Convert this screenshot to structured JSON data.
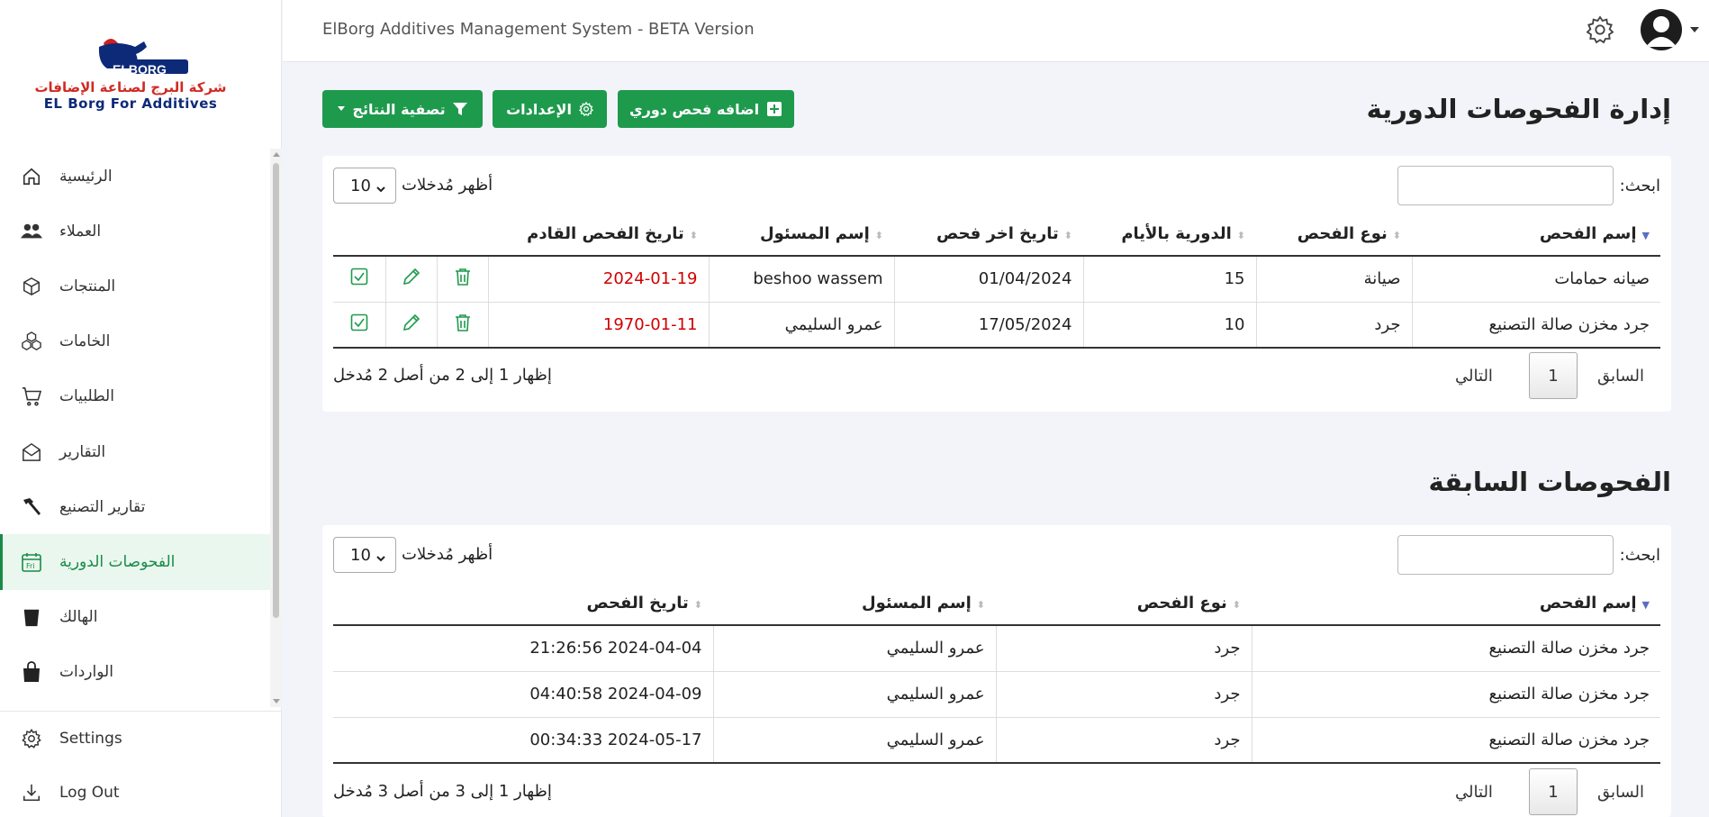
{
  "brand": {
    "logo_text": "ELBORG",
    "arabic_name": "شركة البرج لصناعة الإضافات",
    "english_name": "EL Borg For Additives"
  },
  "header": {
    "title": "ElBorg Additives Management System - BETA Version"
  },
  "sidebar": {
    "items": [
      {
        "label": "الرئيسية",
        "icon": "home-icon"
      },
      {
        "label": "العملاء",
        "icon": "users-icon"
      },
      {
        "label": "المنتجات",
        "icon": "box-icon"
      },
      {
        "label": "الخامات",
        "icon": "cubes-icon"
      },
      {
        "label": "الطلبيات",
        "icon": "cart-icon"
      },
      {
        "label": "التقارير",
        "icon": "envelope-icon"
      },
      {
        "label": "تقارير التصنيع",
        "icon": "hammer-icon"
      },
      {
        "label": "الفحوصات الدورية",
        "icon": "calendar-icon"
      },
      {
        "label": "الهالك",
        "icon": "trash-can-icon"
      },
      {
        "label": "الواردات",
        "icon": "shopping-bag-icon"
      }
    ],
    "settings_label": "Settings",
    "logout_label": "Log Out"
  },
  "page": {
    "title": "إدارة الفحوصات الدورية",
    "add_button": "اضافه فحص دوري",
    "settings_button": "الإعدادات",
    "filter_button": "تصفية النتائج"
  },
  "periodic": {
    "search_label": "ابحث:",
    "length_label": "أظهر مُدخلات",
    "length_value": "10",
    "columns": [
      "إسم الفحص",
      "نوع الفحص",
      "الدورية بالأيام",
      "تاريخ اخر فحص",
      "إسم المسئول",
      "تاريخ الفحص القادم"
    ],
    "rows": [
      [
        "صيانه حمامات",
        "صيانة",
        "15",
        "01/04/2024",
        "beshoo wassem",
        "2024-01-19"
      ],
      [
        "جرد مخزن صالة التصنيع",
        "جرد",
        "10",
        "17/05/2024",
        "عمرو السليمي",
        "1970-01-11"
      ]
    ],
    "info": "إظهار 1 إلى 2 من أصل 2 مُدخل",
    "prev": "السابق",
    "page": "1",
    "next": "التالي"
  },
  "previous": {
    "title": "الفحوصات السابقة",
    "search_label": "ابحث:",
    "length_label": "أظهر مُدخلات",
    "length_value": "10",
    "columns": [
      "إسم الفحص",
      "نوع الفحص",
      "إسم المسئول",
      "تاريخ الفحص"
    ],
    "rows": [
      [
        "جرد مخزن صالة التصنيع",
        "جرد",
        "عمرو السليمي",
        "2024-04-04 21:26:56"
      ],
      [
        "جرد مخزن صالة التصنيع",
        "جرد",
        "عمرو السليمي",
        "2024-04-09 04:40:58"
      ],
      [
        "جرد مخزن صالة التصنيع",
        "جرد",
        "عمرو السليمي",
        "2024-05-17 00:34:33"
      ]
    ],
    "info": "إظهار 1 إلى 3 من أصل 3 مُدخل",
    "prev": "السابق",
    "page": "1",
    "next": "التالي"
  },
  "colors": {
    "accent": "#1e9a4d",
    "danger": "#d10000"
  }
}
